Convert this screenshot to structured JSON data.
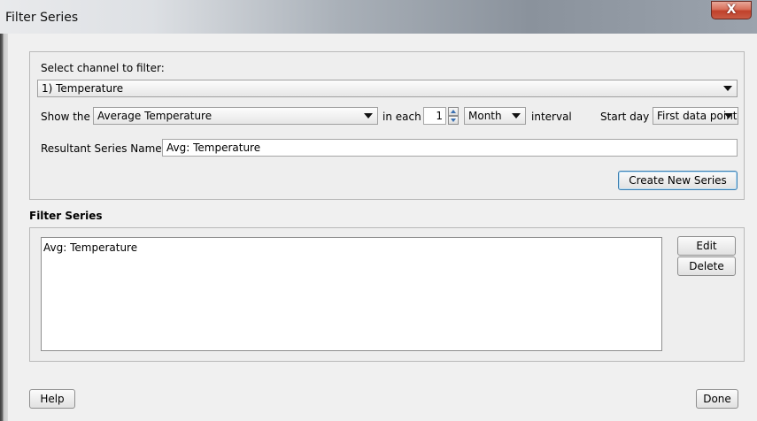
{
  "window": {
    "title": "Filter Series",
    "close_label": "X"
  },
  "filter": {
    "channel_label": "Select channel to filter:",
    "channel_value": "1) Temperature",
    "show_label": "Show the",
    "function_value": "Average Temperature",
    "in_each_label": "in each",
    "interval_count": "1",
    "interval_unit": "Month",
    "interval_label": "interval",
    "start_day_label": "Start day",
    "start_day_value": "First data point",
    "result_name_label": "Resultant Series Name:",
    "result_name_value": "Avg: Temperature",
    "create_button": "Create New Series"
  },
  "series_section": {
    "heading": "Filter Series",
    "items": [
      "Avg: Temperature"
    ],
    "edit_button": "Edit",
    "delete_button": "Delete"
  },
  "footer": {
    "help_button": "Help",
    "done_button": "Done"
  }
}
